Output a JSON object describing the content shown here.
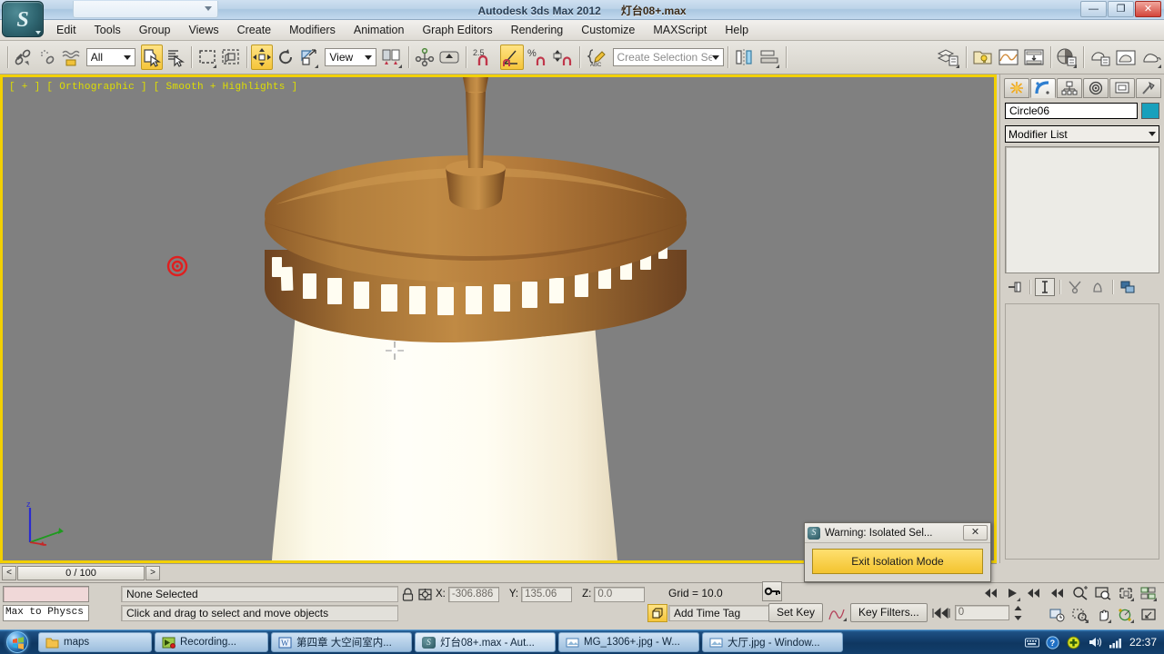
{
  "window": {
    "app_title": "Autodesk 3ds Max  2012",
    "file_name": "灯台08+.max",
    "minimize_label": "—",
    "maximize_label": "❐",
    "close_label": "✕"
  },
  "menu": {
    "items": [
      {
        "label": "Edit"
      },
      {
        "label": "Tools"
      },
      {
        "label": "Group"
      },
      {
        "label": "Views"
      },
      {
        "label": "Create"
      },
      {
        "label": "Modifiers"
      },
      {
        "label": "Animation"
      },
      {
        "label": "Graph Editors"
      },
      {
        "label": "Rendering"
      },
      {
        "label": "Customize"
      },
      {
        "label": "MAXScript"
      },
      {
        "label": "Help"
      }
    ]
  },
  "toolbar": {
    "selection_filter_value": "All",
    "reference_coord_value": "View",
    "selection_set_placeholder": "Create Selection Set",
    "snap_percent_label": "2.5",
    "icons": [
      "select-and-link-icon",
      "unlink-selection-icon",
      "bind-to-space-warp-icon",
      "selection-filter-dropdown",
      "select-object-icon",
      "select-by-name-icon",
      "rectangular-selection-region-icon",
      "window-crossing-icon",
      "select-and-move-icon",
      "select-and-rotate-icon",
      "select-and-scale-icon",
      "reference-coordinate-system-dropdown",
      "use-pivot-point-center-icon",
      "select-and-manipulate-icon",
      "snaps-toggle-icon",
      "angle-snap-toggle-icon",
      "percent-snap-toggle-icon",
      "spinner-snap-toggle-icon",
      "edit-named-selection-sets-icon",
      "mirror-icon",
      "align-icon",
      "layer-manager-icon",
      "graph-editors-icon",
      "schematic-view-icon",
      "material-editor-icon",
      "render-setup-icon",
      "rendered-frame-window-icon",
      "render-production-icon"
    ]
  },
  "viewport": {
    "label": "[ + ] [ Orthographic ] [ Smooth + Highlights ]",
    "background_color": "#808080",
    "active_border_color": "#f2d000",
    "axis_labels": {
      "z": "z",
      "x": "x",
      "y": "y"
    },
    "object_color_brown": "#b07a3f",
    "object_color_shade": "#8a5c2b",
    "glass_color": "#fffdf0"
  },
  "command_panel": {
    "tabs": [
      {
        "name": "create-tab",
        "icon": "create-star-icon"
      },
      {
        "name": "modify-tab",
        "icon": "modify-arc-icon"
      },
      {
        "name": "hierarchy-tab",
        "icon": "hierarchy-icon"
      },
      {
        "name": "motion-tab",
        "icon": "motion-target-icon"
      },
      {
        "name": "display-tab",
        "icon": "display-monitor-icon"
      },
      {
        "name": "utilities-tab",
        "icon": "utilities-hammer-icon"
      }
    ],
    "selected_tab_index": 1,
    "object_name": "Circle06",
    "object_color": "#18a0bc",
    "modifier_list_label": "Modifier List",
    "stack_buttons": [
      "pin-stack-icon",
      "show-end-result-icon",
      "make-unique-icon",
      "remove-modifier-icon",
      "configure-modifier-sets-icon"
    ]
  },
  "timeline": {
    "prev_frame_label": "<",
    "next_frame_label": ">",
    "frame_display": "0 / 100"
  },
  "status": {
    "selection_status": "None Selected",
    "prompt": "Click and drag to select and move objects",
    "mini_listener_text": "Max to Physcs (",
    "coords": [
      {
        "label": "X:",
        "value": "-306.886"
      },
      {
        "label": "Y:",
        "value": "135.06"
      },
      {
        "label": "Z:",
        "value": "0.0"
      }
    ],
    "grid_label": "Grid = 10.0",
    "add_time_tag": "Add Time Tag",
    "set_key_label": "Set Key",
    "key_filters_label": "Key Filters...",
    "current_frame": "0",
    "nav_icons": [
      "zoom-icon",
      "zoom-all-icon",
      "zoom-extents-icon",
      "zoom-extents-all-icon",
      "field-of-view-icon",
      "pan-view-icon",
      "orbit-icon",
      "maximize-viewport-toggle-icon"
    ]
  },
  "warning_dialog": {
    "title": "Warning: Isolated Sel...",
    "close_label": "✕",
    "button_label": "Exit Isolation Mode"
  },
  "taskbar": {
    "start_label": "start-orb-icon",
    "tasks": [
      {
        "label": "maps",
        "icon": "folder-icon"
      },
      {
        "label": "Recording...",
        "icon": "recorder-icon"
      },
      {
        "label": "第四章 大空间室内...",
        "icon": "word-doc-icon"
      },
      {
        "label": "灯台08+.max - Aut...",
        "icon": "max-icon"
      },
      {
        "label": "MG_1306+.jpg - W...",
        "icon": "photo-viewer-icon"
      },
      {
        "label": "大厅.jpg - Window...",
        "icon": "photo-viewer-icon"
      }
    ],
    "tray": {
      "keyboard_icon": "keyboard-icon",
      "help_icon": "help-icon",
      "updates_icon": "updates-icon",
      "volume_icon": "volume-icon",
      "network_icon": "network-icon",
      "clock": "22:37"
    }
  }
}
